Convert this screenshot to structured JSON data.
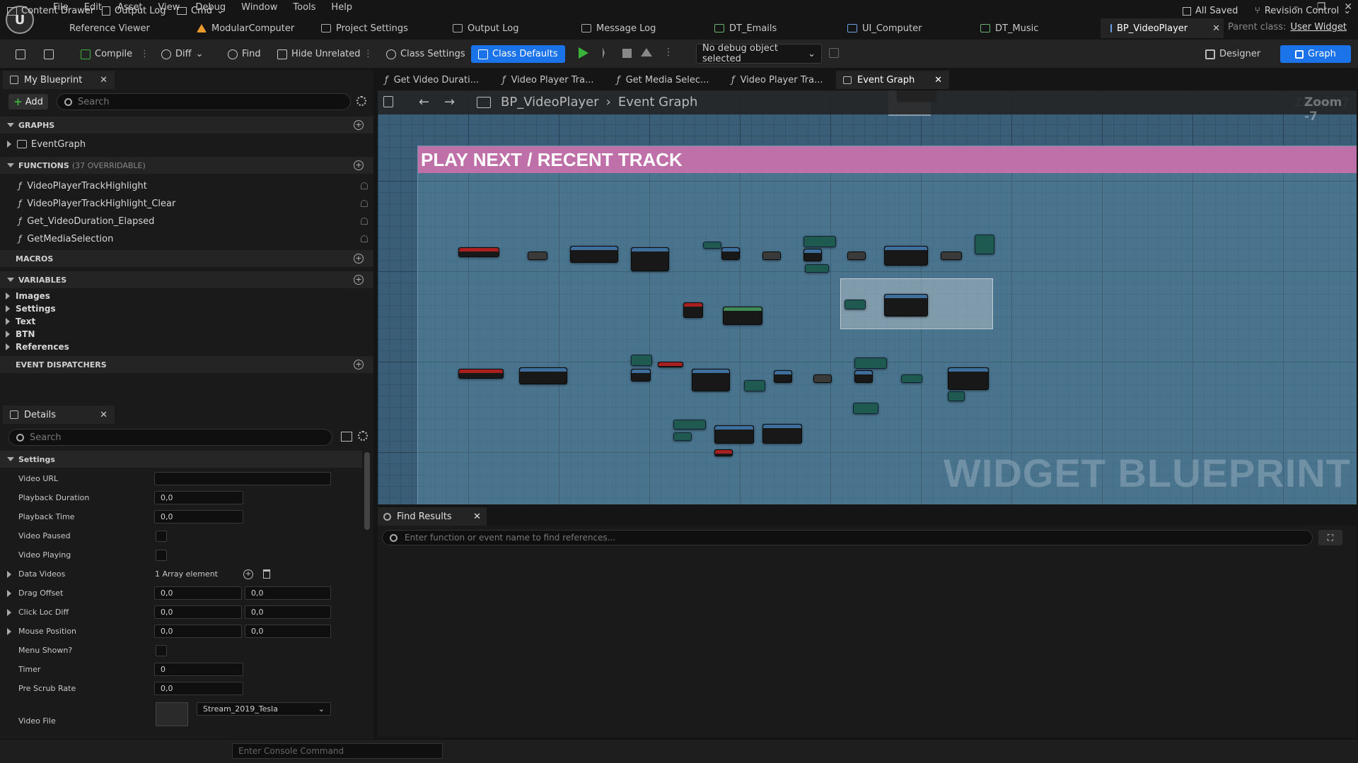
{
  "menu": [
    "File",
    "Edit",
    "Asset",
    "View",
    "Debug",
    "Window",
    "Tools",
    "Help"
  ],
  "doc_tabs": [
    {
      "label": "Reference Viewer"
    },
    {
      "label": "ModularComputer"
    },
    {
      "label": "Project Settings"
    },
    {
      "label": "Output Log"
    },
    {
      "label": "Message Log"
    },
    {
      "label": "DT_Emails"
    },
    {
      "label": "UI_Computer"
    },
    {
      "label": "DT_Music"
    },
    {
      "label": "BP_VideoPlayer"
    }
  ],
  "parent_class": {
    "label": "Parent class:",
    "value": "User Widget"
  },
  "toolbar": {
    "compile": "Compile",
    "diff": "Diff",
    "find": "Find",
    "hide_unrelated": "Hide Unrelated",
    "class_settings": "Class Settings",
    "class_defaults": "Class Defaults",
    "debug_select": "No debug object selected",
    "designer": "Designer",
    "graph": "Graph"
  },
  "my_blueprint": {
    "tab_label": "My Blueprint",
    "add_label": "Add",
    "search_placeholder": "Search",
    "graphs_header": "GRAPHS",
    "graphs": [
      "EventGraph"
    ],
    "functions_header": "FUNCTIONS",
    "functions_overridable": "(37 OVERRIDABLE)",
    "functions": [
      "VideoPlayerTrackHighlight",
      "VideoPlayerTrackHighlight_Clear",
      "Get_VideoDuration_Elapsed",
      "GetMediaSelection"
    ],
    "macros_header": "MACROS",
    "variables_header": "VARIABLES",
    "variable_categories": [
      "Images",
      "Settings",
      "Text",
      "BTN",
      "References"
    ],
    "event_dispatchers_header": "EVENT DISPATCHERS"
  },
  "details": {
    "tab_label": "Details",
    "search_placeholder": "Search",
    "section": "Settings",
    "video_url_label": "Video URL",
    "video_url_value": "",
    "playback_duration_label": "Playback Duration",
    "playback_duration_value": "0,0",
    "playback_time_label": "Playback Time",
    "playback_time_value": "0,0",
    "video_paused_label": "Video Paused",
    "video_playing_label": "Video Playing",
    "data_videos_label": "Data Videos",
    "data_videos_value": "1 Array element",
    "drag_offset_label": "Drag Offset",
    "drag_offset_x": "0,0",
    "drag_offset_y": "0,0",
    "click_loc_diff_label": "Click Loc Diff",
    "click_loc_diff_x": "0,0",
    "click_loc_diff_y": "0,0",
    "mouse_position_label": "Mouse Position",
    "mouse_position_x": "0,0",
    "mouse_position_y": "0,0",
    "menu_shown_label": "Menu Shown?",
    "timer_label": "Timer",
    "timer_value": "0",
    "pre_scrub_rate_label": "Pre Scrub Rate",
    "pre_scrub_rate_value": "0,0",
    "video_file_label": "Video File",
    "video_file_value": "Stream_2019_Tesla"
  },
  "graph_tabs": [
    "Get Video Durati...",
    "Video Player Tra...",
    "Get Media Selec...",
    "Video Player Tra...",
    "Event Graph"
  ],
  "graph": {
    "breadcrumb_root": "BP_VideoPlayer",
    "breadcrumb_leaf": "Event Graph",
    "zoom": "Zoom -7",
    "comment_title": "PLAY NEXT / RECENT TRACK",
    "watermark": "WIDGET BLUEPRINT"
  },
  "find_results": {
    "tab_label": "Find Results",
    "placeholder": "Enter function or event name to find references..."
  },
  "statusbar": {
    "content_drawer": "Content Drawer",
    "output_log": "Output Log",
    "cmd": "Cmd",
    "console_placeholder": "Enter Console Command",
    "all_saved": "All Saved",
    "revision_control": "Revision Control"
  },
  "colors": {
    "accent": "#1a73e8",
    "comment": "#c070a8",
    "graph_bg": "#3a5e78",
    "play": "#3bb33b"
  }
}
